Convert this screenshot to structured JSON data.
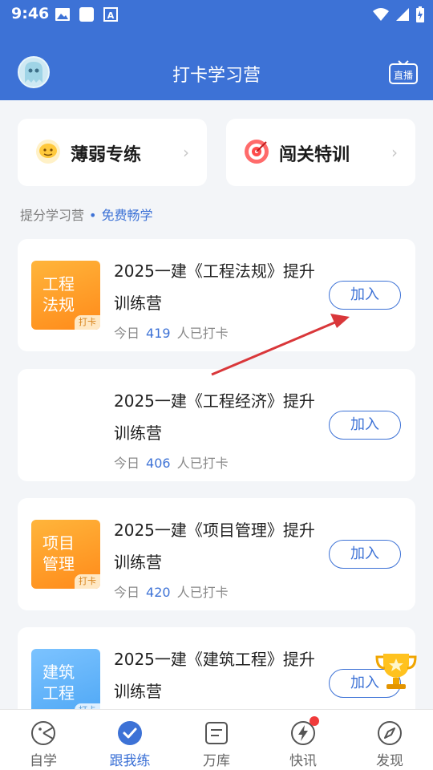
{
  "status_bar": {
    "time": "9:46"
  },
  "header": {
    "title": "打卡学习营",
    "live_label": "直播"
  },
  "quick_cards": [
    {
      "label": "薄弱专练",
      "icon": "chat-face-icon"
    },
    {
      "label": "闯关特训",
      "icon": "target-icon"
    }
  ],
  "subheader": {
    "left": "提分学习营",
    "right": "免费畅学"
  },
  "courses": [
    {
      "thumb_title_1": "工程",
      "thumb_title_2": "法规",
      "tag": "打卡",
      "title": "2025一建《工程法规》提升训练营",
      "stats_prefix": "今日",
      "count": "419",
      "stats_suffix": "人已打卡",
      "button": "加入"
    },
    {
      "thumb_title_1": "",
      "thumb_title_2": "",
      "tag": "",
      "title": "2025一建《工程经济》提升训练营",
      "stats_prefix": "今日",
      "count": "406",
      "stats_suffix": "人已打卡",
      "button": "加入"
    },
    {
      "thumb_title_1": "项目",
      "thumb_title_2": "管理",
      "tag": "打卡",
      "title": "2025一建《项目管理》提升训练营",
      "stats_prefix": "今日",
      "count": "420",
      "stats_suffix": "人已打卡",
      "button": "加入"
    },
    {
      "thumb_title_1": "建筑",
      "thumb_title_2": "工程",
      "tag": "打卡",
      "title": "2025一建《建筑工程》提升训练营",
      "stats_prefix": "",
      "count": "",
      "stats_suffix": "",
      "button": "加入"
    }
  ],
  "bottom_nav": [
    {
      "label": "自学",
      "icon": "self-study-icon"
    },
    {
      "label": "跟我练",
      "icon": "check-circle-icon",
      "active": true
    },
    {
      "label": "万库",
      "icon": "doc-library-icon"
    },
    {
      "label": "快讯",
      "icon": "lightning-icon",
      "badge": true
    },
    {
      "label": "发现",
      "icon": "compass-icon"
    }
  ],
  "colors": {
    "primary": "#3d72d6",
    "orange": "#ff9a22",
    "annotation_arrow": "#d9373a"
  }
}
